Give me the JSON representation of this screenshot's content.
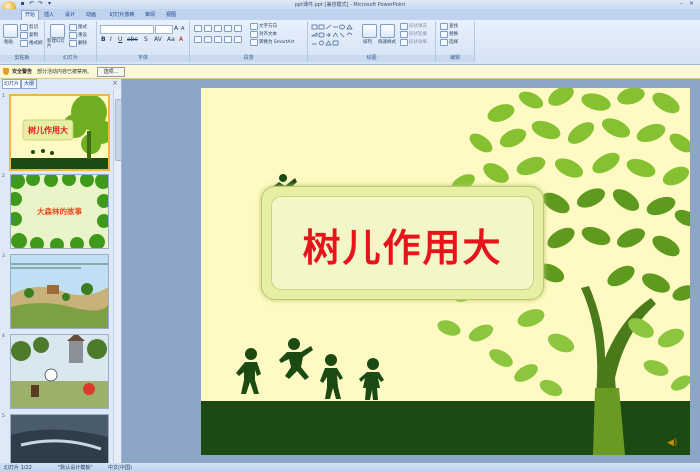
{
  "window": {
    "title": "ppt课件.ppt [兼容模式] - Microsoft PowerPoint"
  },
  "tabs": [
    "开始",
    "插入",
    "设计",
    "动画",
    "幻灯片放映",
    "审阅",
    "视图"
  ],
  "ribbon": {
    "clipboard": {
      "label": "剪贴板",
      "paste": "粘贴",
      "cut": "剪切",
      "copy": "复制",
      "format_painter": "格式刷"
    },
    "slides": {
      "label": "幻灯片",
      "new_slide": "新建幻灯片",
      "layout": "版式",
      "reset": "重设",
      "delete": "删除"
    },
    "font": {
      "label": "字体"
    },
    "paragraph": {
      "label": "段落",
      "text_direction": "文字方向",
      "align_text": "对齐文本",
      "smartart": "转换为 SmartArt"
    },
    "drawing": {
      "label": "绘图",
      "arrange": "排列",
      "quick_styles": "快速样式",
      "shape_fill": "形状填充",
      "shape_outline": "形状轮廓",
      "shape_effects": "形状效果"
    },
    "editing": {
      "label": "编辑",
      "find": "查找",
      "replace": "替换",
      "select": "选择"
    }
  },
  "security_bar": {
    "title": "安全警告",
    "message": "部分活动内容已被禁用。",
    "options_button": "选项..."
  },
  "left_pane": {
    "tabs": [
      "幻灯片",
      "大纲"
    ],
    "close": "×"
  },
  "thumbnails": [
    {
      "number": "1",
      "title": "树儿作用大"
    },
    {
      "number": "2",
      "title": "大森林的故事"
    },
    {
      "number": "3",
      "title": ""
    },
    {
      "number": "4",
      "title": ""
    },
    {
      "number": "5",
      "title": ""
    }
  ],
  "slide": {
    "title": "树儿作用大"
  },
  "status_bar": {
    "slide_info": "幻灯片 1/22",
    "theme": "\"默认设计模板\"",
    "language": "中文(中国)"
  },
  "colors": {
    "accent": "#f2b540",
    "title_red": "#e8141c",
    "tree_green": "#5e9a1e",
    "ground": "#1b4a12",
    "slide_bg": "#fffac3"
  }
}
